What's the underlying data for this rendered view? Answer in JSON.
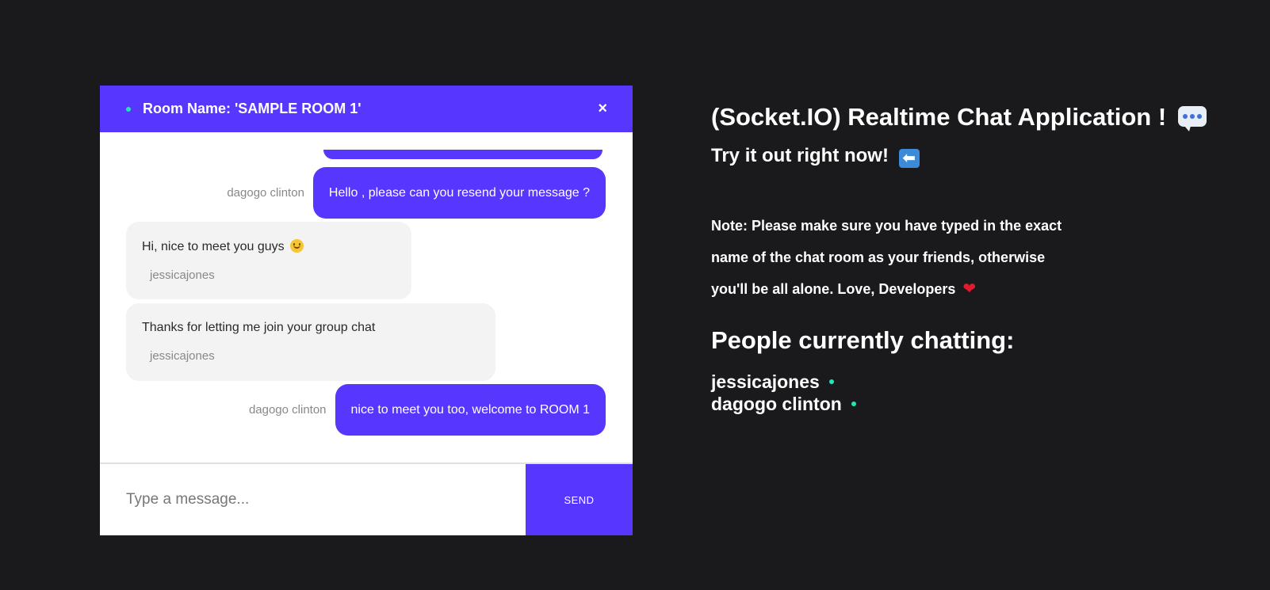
{
  "chat": {
    "room_title": "Room Name: 'SAMPLE ROOM 1'",
    "close_label": "×",
    "messages": [
      {
        "author": "dagogo clinton",
        "text": "Hello , please can you resend your message ?"
      },
      {
        "author": "jessicajones",
        "text": "Hi, nice to meet you guys"
      },
      {
        "author": "jessicajones",
        "text": "Thanks for letting me join your group chat"
      },
      {
        "author": "dagogo clinton",
        "text": "nice to meet you too, welcome to ROOM 1"
      }
    ],
    "input_placeholder": "Type a message...",
    "send_label": "SEND"
  },
  "info": {
    "title": "(Socket.IO) Realtime Chat Application !",
    "subtitle": "Try it out right now!",
    "note": "Note: Please make sure you have typed in the exact name of the chat room as your friends, otherwise you'll be all alone. Love, Developers",
    "people_title": "People currently chatting:",
    "people": [
      "jessicajones",
      "dagogo clinton"
    ]
  },
  "colors": {
    "accent": "#5736fd",
    "background": "#1a1a1d",
    "online": "#1de9b6"
  },
  "icons": {
    "title_icon": "speech-balloon-icon",
    "subtitle_icon": "left-arrow-icon",
    "note_icon": "heart-icon",
    "emoji": "smile-icon"
  }
}
